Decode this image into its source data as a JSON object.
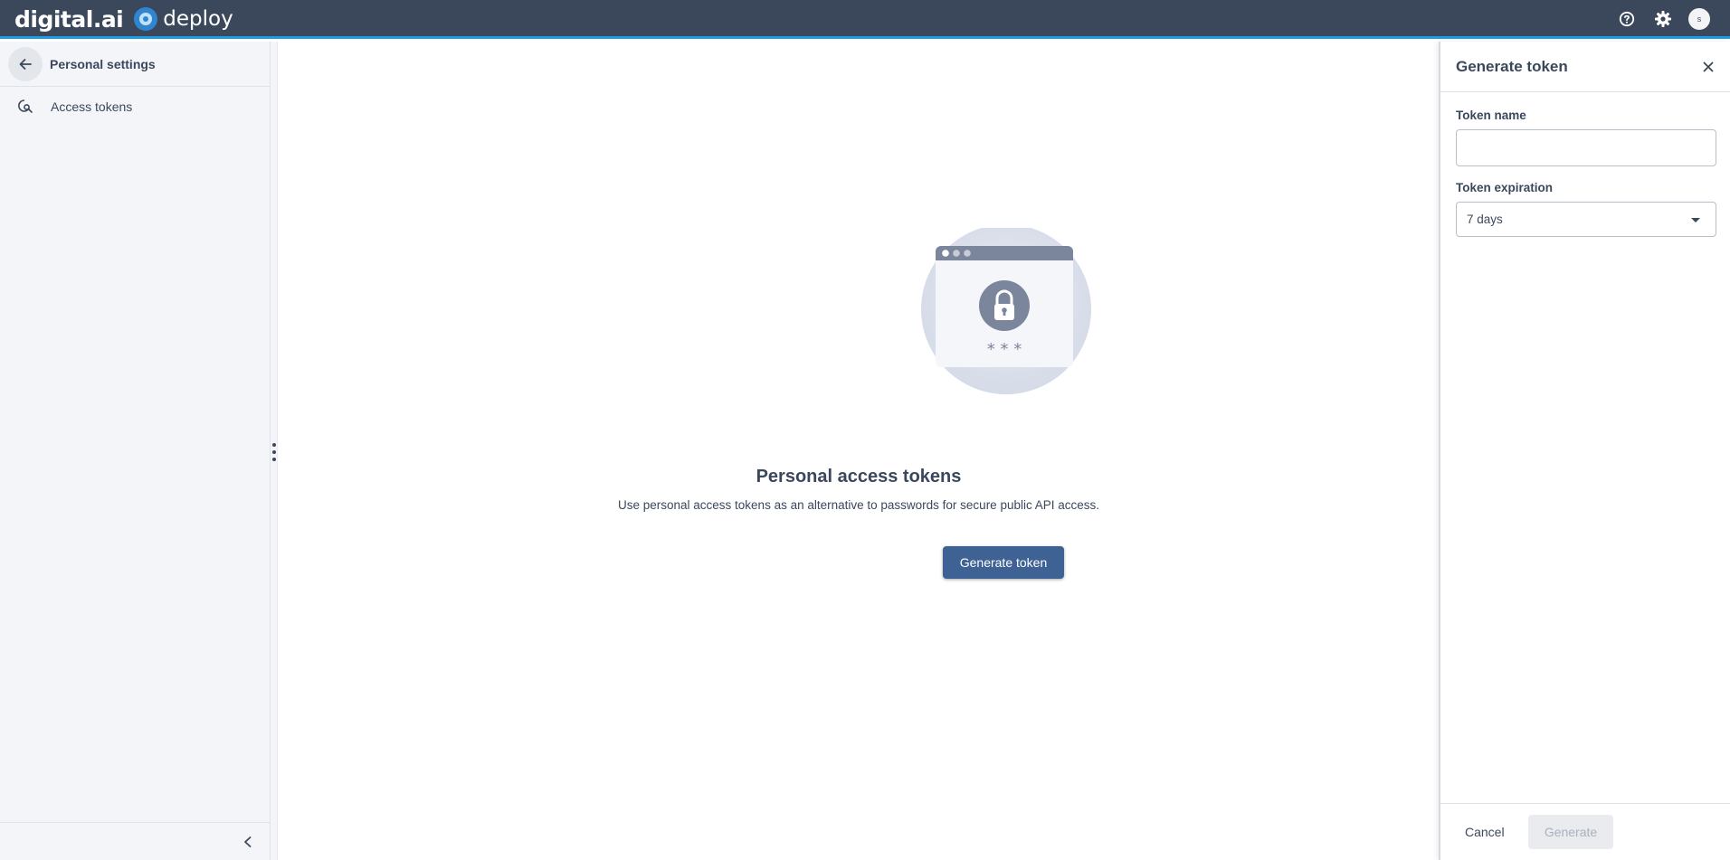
{
  "header": {
    "brand_name": "digital.ai",
    "product_name": "deploy",
    "avatar_initial": "s",
    "icons": [
      "help-icon",
      "gear-icon"
    ]
  },
  "sidebar": {
    "title": "Personal settings",
    "items": [
      {
        "label": "Access tokens",
        "icon": "key-search-icon"
      }
    ]
  },
  "main": {
    "title": "Personal access tokens",
    "description": "Use personal access tokens as an alternative to passwords for secure public API access.",
    "button_label": "Generate token",
    "illustration_text": "* * *"
  },
  "drawer": {
    "title": "Generate token",
    "token_name_label": "Token name",
    "token_name_value": "",
    "token_expiration_label": "Token expiration",
    "token_expiration_value": "7 days",
    "cancel_label": "Cancel",
    "generate_label": "Generate"
  },
  "colors": {
    "header_bg": "#3b485c",
    "accent_line": "#1e9be5",
    "primary_button": "#3d6293",
    "text": "#3b485c",
    "sidebar_bg": "#f3f5f8"
  }
}
